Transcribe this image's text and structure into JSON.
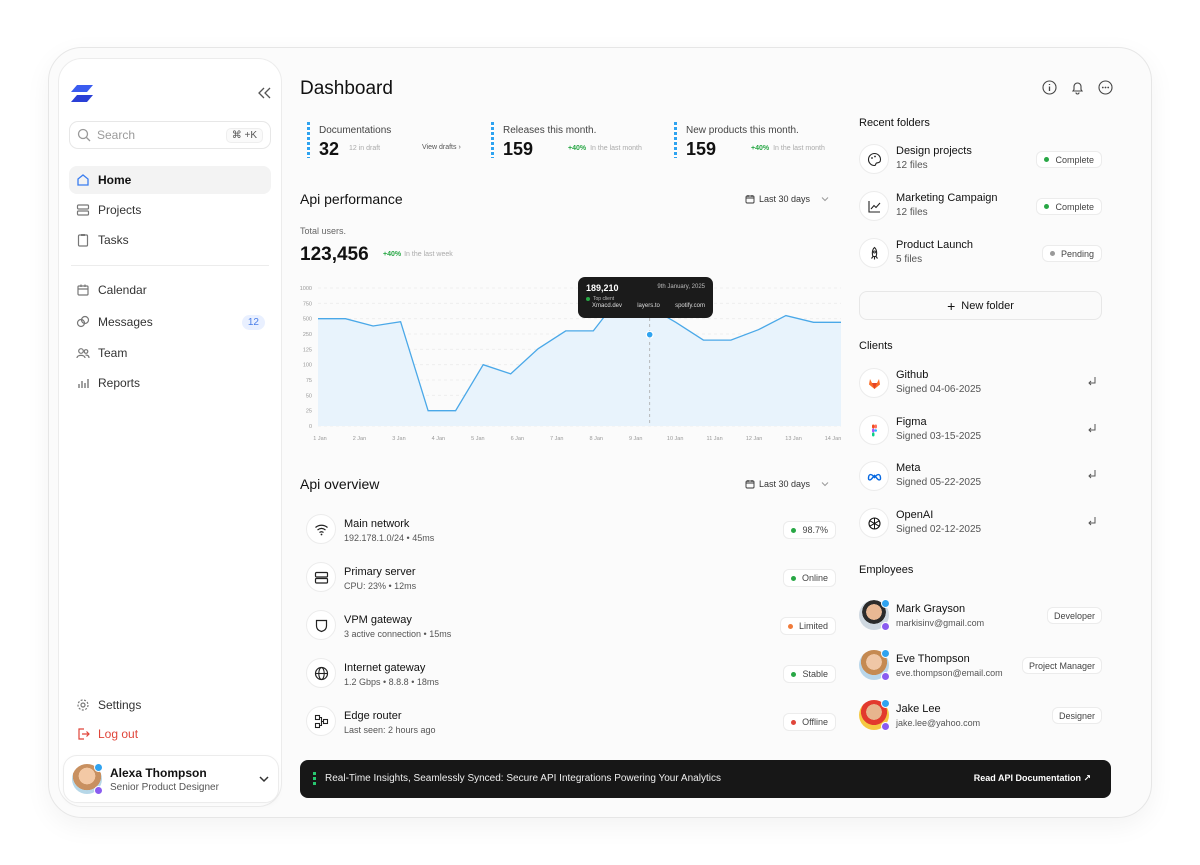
{
  "sidebar": {
    "search_placeholder": "Search",
    "search_shortcut": "⌘ +K",
    "nav": [
      {
        "label": "Home",
        "icon": "home-icon"
      },
      {
        "label": "Projects",
        "icon": "projects-icon"
      },
      {
        "label": "Tasks",
        "icon": "tasks-icon"
      },
      {
        "label": "Calendar",
        "icon": "calendar-icon"
      },
      {
        "label": "Messages",
        "icon": "messages-icon",
        "badge": "12"
      },
      {
        "label": "Team",
        "icon": "team-icon"
      },
      {
        "label": "Reports",
        "icon": "reports-icon"
      }
    ],
    "settings": "Settings",
    "logout": "Log out",
    "user": {
      "name": "Alexa Thompson",
      "role": "Senior Product Designer"
    }
  },
  "header": {
    "title": "Dashboard"
  },
  "stats": [
    {
      "label": "Documentations",
      "value": "32",
      "sub": "12 in draft",
      "link": "View drafts"
    },
    {
      "label": "Releases this month.",
      "value": "159",
      "pct": "+40%",
      "sub": "In the last month"
    },
    {
      "label": "New products this month.",
      "value": "159",
      "pct": "+40%",
      "sub": "In the last month"
    }
  ],
  "performance": {
    "title": "Api performance",
    "range": "Last 30 days",
    "total_label": "Total users.",
    "total_value": "123,456",
    "total_pct": "+40%",
    "total_sub": "In the last week"
  },
  "chart_data": {
    "type": "area",
    "x": [
      "1 Jan",
      "2 Jan",
      "3 Jan",
      "4 Jan",
      "5 Jan",
      "6 Jan",
      "7 Jan",
      "8 Jan",
      "9 Jan",
      "10 Jan",
      "11 Jan",
      "12 Jan",
      "13 Jan",
      "14 Jan"
    ],
    "y_ticks": [
      0,
      25,
      50,
      75,
      100,
      125,
      250,
      500,
      750,
      1000
    ],
    "series": [
      {
        "values": [
          500,
          500,
          380,
          450,
          25,
          25,
          100,
          85,
          130,
          300,
          300,
          880,
          700,
          440,
          200,
          200,
          320,
          550,
          440,
          440
        ]
      }
    ],
    "tooltip": {
      "value": "189,210",
      "date": "9th January, 2025",
      "label": "Top client",
      "clients": [
        "Xmacd.dev",
        "layers.to",
        "spotify.com"
      ]
    },
    "color": "#4aa8e8"
  },
  "overview": {
    "title": "Api overview",
    "range": "Last 30 days",
    "items": [
      {
        "name": "Main network",
        "sub": "192.178.1.0/24 • 45ms",
        "status": "98.7%",
        "color": "#28a745",
        "icon": "wifi-icon"
      },
      {
        "name": "Primary server",
        "sub": "CPU: 23% • 12ms",
        "status": "Online",
        "color": "#28a745",
        "icon": "server-icon"
      },
      {
        "name": "VPM gateway",
        "sub": "3 active connection • 15ms",
        "status": "Limited",
        "color": "#f07b3a",
        "icon": "shield-icon"
      },
      {
        "name": "Internet gateway",
        "sub": "1.2 Gbps • 8.8.8 • 18ms",
        "status": "Stable",
        "color": "#28a745",
        "icon": "globe-icon"
      },
      {
        "name": "Edge router",
        "sub": "Last seen: 2 hours ago",
        "status": "Offline",
        "color": "#e0453a",
        "icon": "router-icon"
      }
    ]
  },
  "banner": {
    "message": "Real-Time Insights, Seamlessly Synced: Secure API Integrations Powering Your Analytics",
    "link": "Read API Documentation ↗"
  },
  "folders": {
    "title": "Recent folders",
    "items": [
      {
        "name": "Design projects",
        "files": "12 files",
        "status": "Complete",
        "color": "#28a745",
        "icon": "palette-icon"
      },
      {
        "name": "Marketing Campaign",
        "files": "12 files",
        "status": "Complete",
        "color": "#28a745",
        "icon": "chart-line-icon"
      },
      {
        "name": "Product Launch",
        "files": "5 files",
        "status": "Pending",
        "color": "#9a9a9a",
        "icon": "rocket-icon"
      }
    ],
    "new_folder": "New folder"
  },
  "clients": {
    "title": "Clients",
    "items": [
      {
        "name": "Github",
        "signed": "Signed 04-06-2025",
        "icon": "gitlab-logo-icon"
      },
      {
        "name": "Figma",
        "signed": "Signed 03-15-2025",
        "icon": "figma-logo-icon"
      },
      {
        "name": "Meta",
        "signed": "Signed 05-22-2025",
        "icon": "meta-logo-icon"
      },
      {
        "name": "OpenAI",
        "signed": "Signed 02-12-2025",
        "icon": "openai-logo-icon"
      }
    ]
  },
  "employees": {
    "title": "Employees",
    "items": [
      {
        "name": "Mark Grayson",
        "email": "markisinv@gmail.com",
        "role": "Developer"
      },
      {
        "name": "Eve Thompson",
        "email": "eve.thompson@email.com",
        "role": "Project Manager"
      },
      {
        "name": "Jake Lee",
        "email": "jake.lee@yahoo.com",
        "role": "Designer"
      }
    ]
  }
}
